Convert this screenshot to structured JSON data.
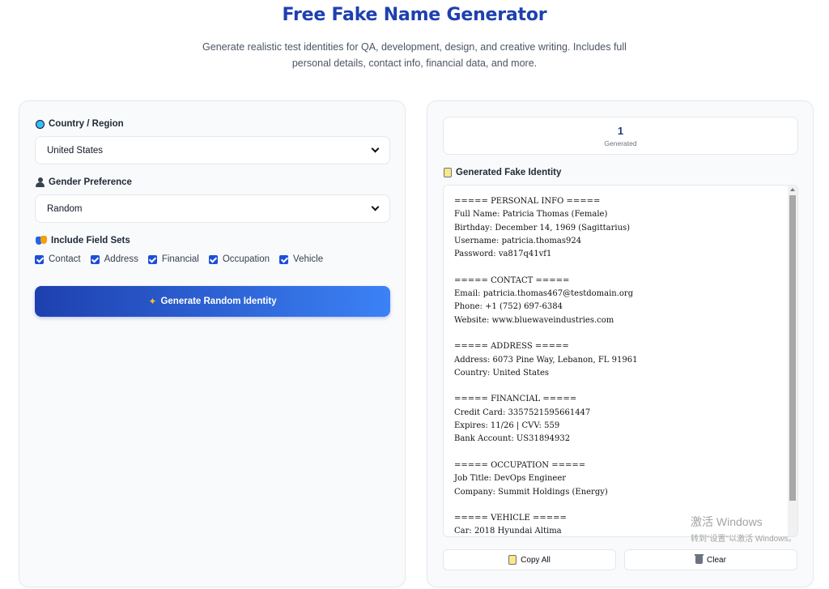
{
  "header": {
    "title": "Free Fake Name Generator",
    "subtitle": "Generate realistic test identities for QA, development, design, and creative writing. Includes full personal details, contact info, financial data, and more."
  },
  "settings": {
    "country_label": "Country / Region",
    "country_value": "United States",
    "gender_label": "Gender Preference",
    "gender_value": "Random",
    "fields_label": "Include Field Sets",
    "field_sets": [
      "Contact",
      "Address",
      "Financial",
      "Occupation",
      "Vehicle"
    ],
    "generate_label": "Generate Random Identity"
  },
  "stats": {
    "count": "1",
    "count_label": "Generated"
  },
  "output": {
    "label": "Generated Fake Identity",
    "text": "===== PERSONAL INFO =====\nFull Name: Patricia Thomas (Female)\nBirthday: December 14, 1969 (Sagittarius)\nUsername: patricia.thomas924\nPassword: va817q41vf1\n\n===== CONTACT =====\nEmail: patricia.thomas467@testdomain.org\nPhone: +1 (752) 697-6384\nWebsite: www.bluewaveindustries.com\n\n===== ADDRESS =====\nAddress: 6073 Pine Way, Lebanon, FL 91961\nCountry: United States\n\n===== FINANCIAL =====\nCredit Card: 3357521595661447\nExpires: 11/26 | CVV: 559\nBank Account: US31894932\n\n===== OCCUPATION =====\nJob Title: DevOps Engineer\nCompany: Summit Holdings (Energy)\n\n===== VEHICLE =====\nCar: 2018 Hyundai Altima"
  },
  "actions": {
    "copy_label": "Copy All",
    "clear_label": "Clear"
  },
  "watermark": {
    "line1": "激活 Windows",
    "line2": "转到\"设置\"以激活 Windows。"
  },
  "colors": {
    "accent": "#1e40af",
    "accent_light": "#3b82f6"
  }
}
